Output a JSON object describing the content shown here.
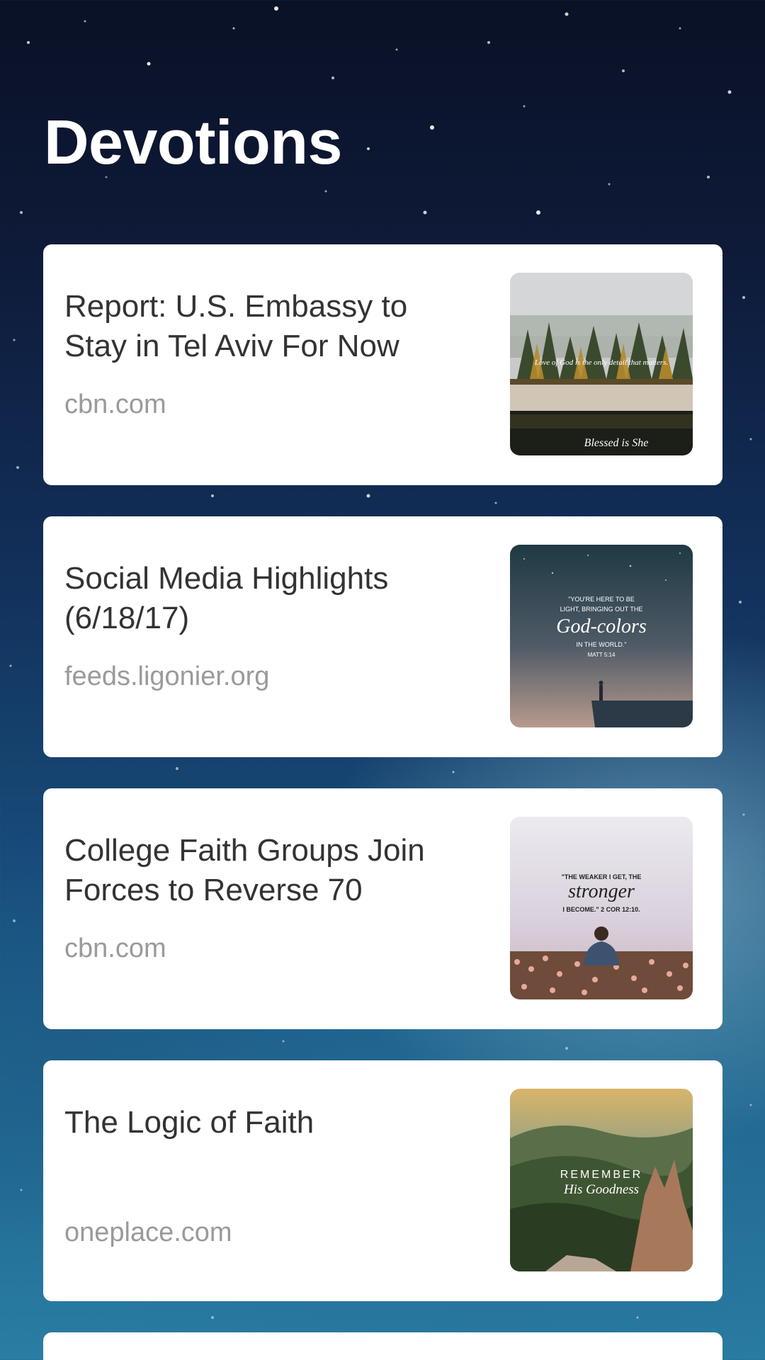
{
  "header": {
    "title": "Devotions"
  },
  "articles": [
    {
      "title": "Report: U.S. Embassy to Stay in Tel Aviv For Now",
      "source": "cbn.com",
      "thumb": {
        "line1": "Love of God is the only detail that matters.",
        "line2": "Blessed is She"
      }
    },
    {
      "title": "Social Media Highlights (6/18/17)",
      "source": "feeds.ligonier.org",
      "thumb": {
        "line1": "\"YOU'RE HERE TO BE",
        "line2": "LIGHT, BRINGING OUT THE",
        "line3": "God-colors",
        "line4": "IN THE WORLD.\"",
        "line5": "MATT 5:14"
      }
    },
    {
      "title": "College Faith Groups Join Forces to Reverse 70",
      "source": "cbn.com",
      "thumb": {
        "line1": "\"THE WEAKER I GET, THE",
        "line2": "stronger",
        "line3": "I BECOME.\" 2 COR 12:10."
      }
    },
    {
      "title": "The Logic of Faith",
      "source": "oneplace.com",
      "thumb": {
        "line1": "REMEMBER",
        "line2": "His Goodness"
      }
    }
  ]
}
